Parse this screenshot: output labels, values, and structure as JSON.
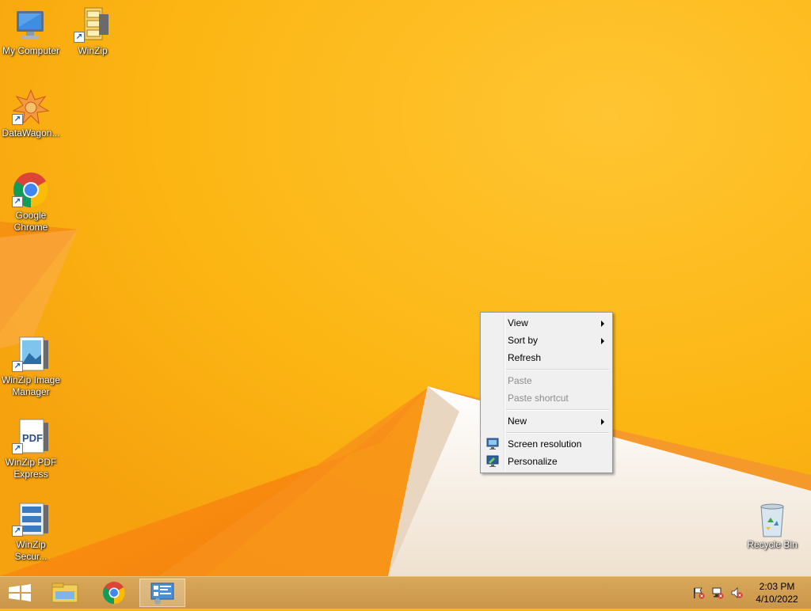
{
  "desktop": {
    "icons": [
      {
        "label": "My Computer"
      },
      {
        "label": "WinZip"
      },
      {
        "label": "DataWagon..."
      },
      {
        "label": "Google Chrome"
      },
      {
        "label": "WinZip Image Manager"
      },
      {
        "label": "WinZip PDF Express"
      },
      {
        "label": "WinZip Secur..."
      },
      {
        "label": "Recycle Bin"
      }
    ]
  },
  "context_menu": {
    "items": [
      {
        "label": "View",
        "submenu": true
      },
      {
        "label": "Sort by",
        "submenu": true
      },
      {
        "label": "Refresh"
      },
      {
        "label": "Paste",
        "disabled": true
      },
      {
        "label": "Paste shortcut",
        "disabled": true
      },
      {
        "label": "New",
        "submenu": true
      },
      {
        "label": "Screen resolution",
        "icon": "monitor-icon"
      },
      {
        "label": "Personalize",
        "icon": "personalize-icon"
      }
    ]
  },
  "taskbar": {
    "buttons": [
      {
        "icon": "windows-start-icon"
      },
      {
        "icon": "file-explorer-icon"
      },
      {
        "icon": "chrome-icon"
      },
      {
        "icon": "control-panel-icon",
        "active": true
      }
    ],
    "tray": [
      {
        "icon": "action-center-flag-icon"
      },
      {
        "icon": "network-icon"
      },
      {
        "icon": "volume-muted-icon"
      }
    ],
    "clock": {
      "time": "2:03 PM",
      "date": "4/10/2022"
    }
  },
  "colors": {
    "wallpaper": "#fcb913",
    "wallpaper_dark": "#f08c0e",
    "taskbar": "#d0a050"
  }
}
